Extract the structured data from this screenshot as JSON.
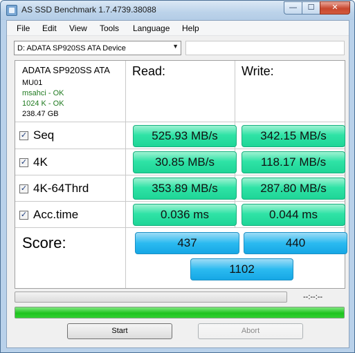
{
  "window": {
    "title": "AS SSD Benchmark 1.7.4739.38088",
    "controls": {
      "minimize": "—",
      "maximize": "☐",
      "close": "✕"
    }
  },
  "menu": {
    "items": [
      "File",
      "Edit",
      "View",
      "Tools",
      "Language",
      "Help"
    ]
  },
  "device": {
    "selected": "D: ADATA SP920SS ATA Device",
    "path_value": ""
  },
  "drive_info": {
    "name": "ADATA SP920SS ATA",
    "firmware": "MU01",
    "driver_status": "msahci - OK",
    "alignment_status": "1024 K - OK",
    "capacity": "238.47 GB"
  },
  "columns": {
    "read": "Read:",
    "write": "Write:"
  },
  "tests": [
    {
      "label": "Seq",
      "checked": true,
      "read": "525.93 MB/s",
      "write": "342.15 MB/s"
    },
    {
      "label": "4K",
      "checked": true,
      "read": "30.85 MB/s",
      "write": "118.17 MB/s"
    },
    {
      "label": "4K-64Thrd",
      "checked": true,
      "read": "353.89 MB/s",
      "write": "287.80 MB/s"
    },
    {
      "label": "Acc.time",
      "checked": true,
      "read": "0.036 ms",
      "write": "0.044 ms"
    }
  ],
  "score": {
    "label": "Score:",
    "read": "437",
    "write": "440",
    "total": "1102"
  },
  "progress": {
    "elapsed": "--:--:--",
    "overall_fraction": 1.0
  },
  "buttons": {
    "start": "Start",
    "abort": "Abort"
  },
  "colors": {
    "result_green": "#1fd597",
    "score_blue": "#16a7e5",
    "progress_green": "#1fc41f",
    "ok_text": "#1f7a1f"
  }
}
